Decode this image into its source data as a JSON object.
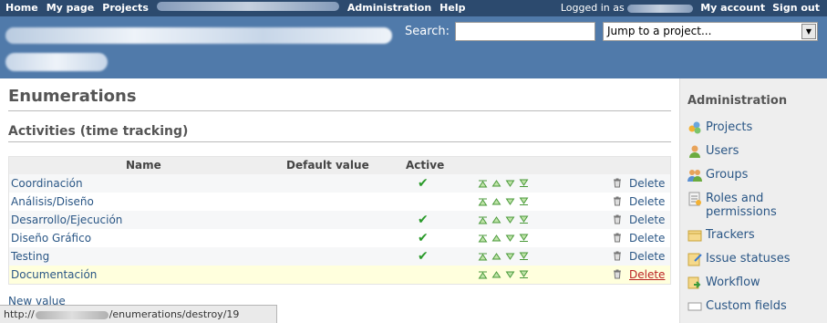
{
  "top_menu": {
    "items": [
      "Home",
      "My page",
      "Projects",
      "Administration",
      "Help"
    ],
    "logged_in_prefix": "Logged in as",
    "my_account": "My account",
    "sign_out": "Sign out"
  },
  "header": {
    "search_label": "Search:",
    "search_value": "",
    "jump_select": "Jump to a project..."
  },
  "main": {
    "title": "Enumerations",
    "section": "Activities (time tracking)",
    "columns": {
      "name": "Name",
      "default": "Default value",
      "active": "Active"
    },
    "rows": [
      {
        "name": "Coordinación",
        "active": "✔",
        "delete": "Delete"
      },
      {
        "name": "Análisis/Diseño",
        "active": "",
        "delete": "Delete"
      },
      {
        "name": "Desarrollo/Ejecución",
        "active": "✔",
        "delete": "Delete"
      },
      {
        "name": "Diseño Gráfico",
        "active": "✔",
        "delete": "Delete"
      },
      {
        "name": "Testing",
        "active": "✔",
        "delete": "Delete"
      },
      {
        "name": "Documentación",
        "active": "",
        "delete": "Delete"
      }
    ],
    "new_value": "New value"
  },
  "sidebar": {
    "title": "Administration",
    "items": [
      {
        "label": "Projects",
        "icon": "projects-icon"
      },
      {
        "label": "Users",
        "icon": "user-icon"
      },
      {
        "label": "Groups",
        "icon": "group-icon"
      },
      {
        "label": "Roles and permissions",
        "icon": "roles-icon"
      },
      {
        "label": "Trackers",
        "icon": "tracker-icon"
      },
      {
        "label": "Issue statuses",
        "icon": "issue-status-icon"
      },
      {
        "label": "Workflow",
        "icon": "workflow-icon"
      },
      {
        "label": "Custom fields",
        "icon": "custom-fields-icon"
      }
    ]
  },
  "status_bar": {
    "prefix": "http://",
    "suffix": "/enumerations/destroy/19"
  }
}
